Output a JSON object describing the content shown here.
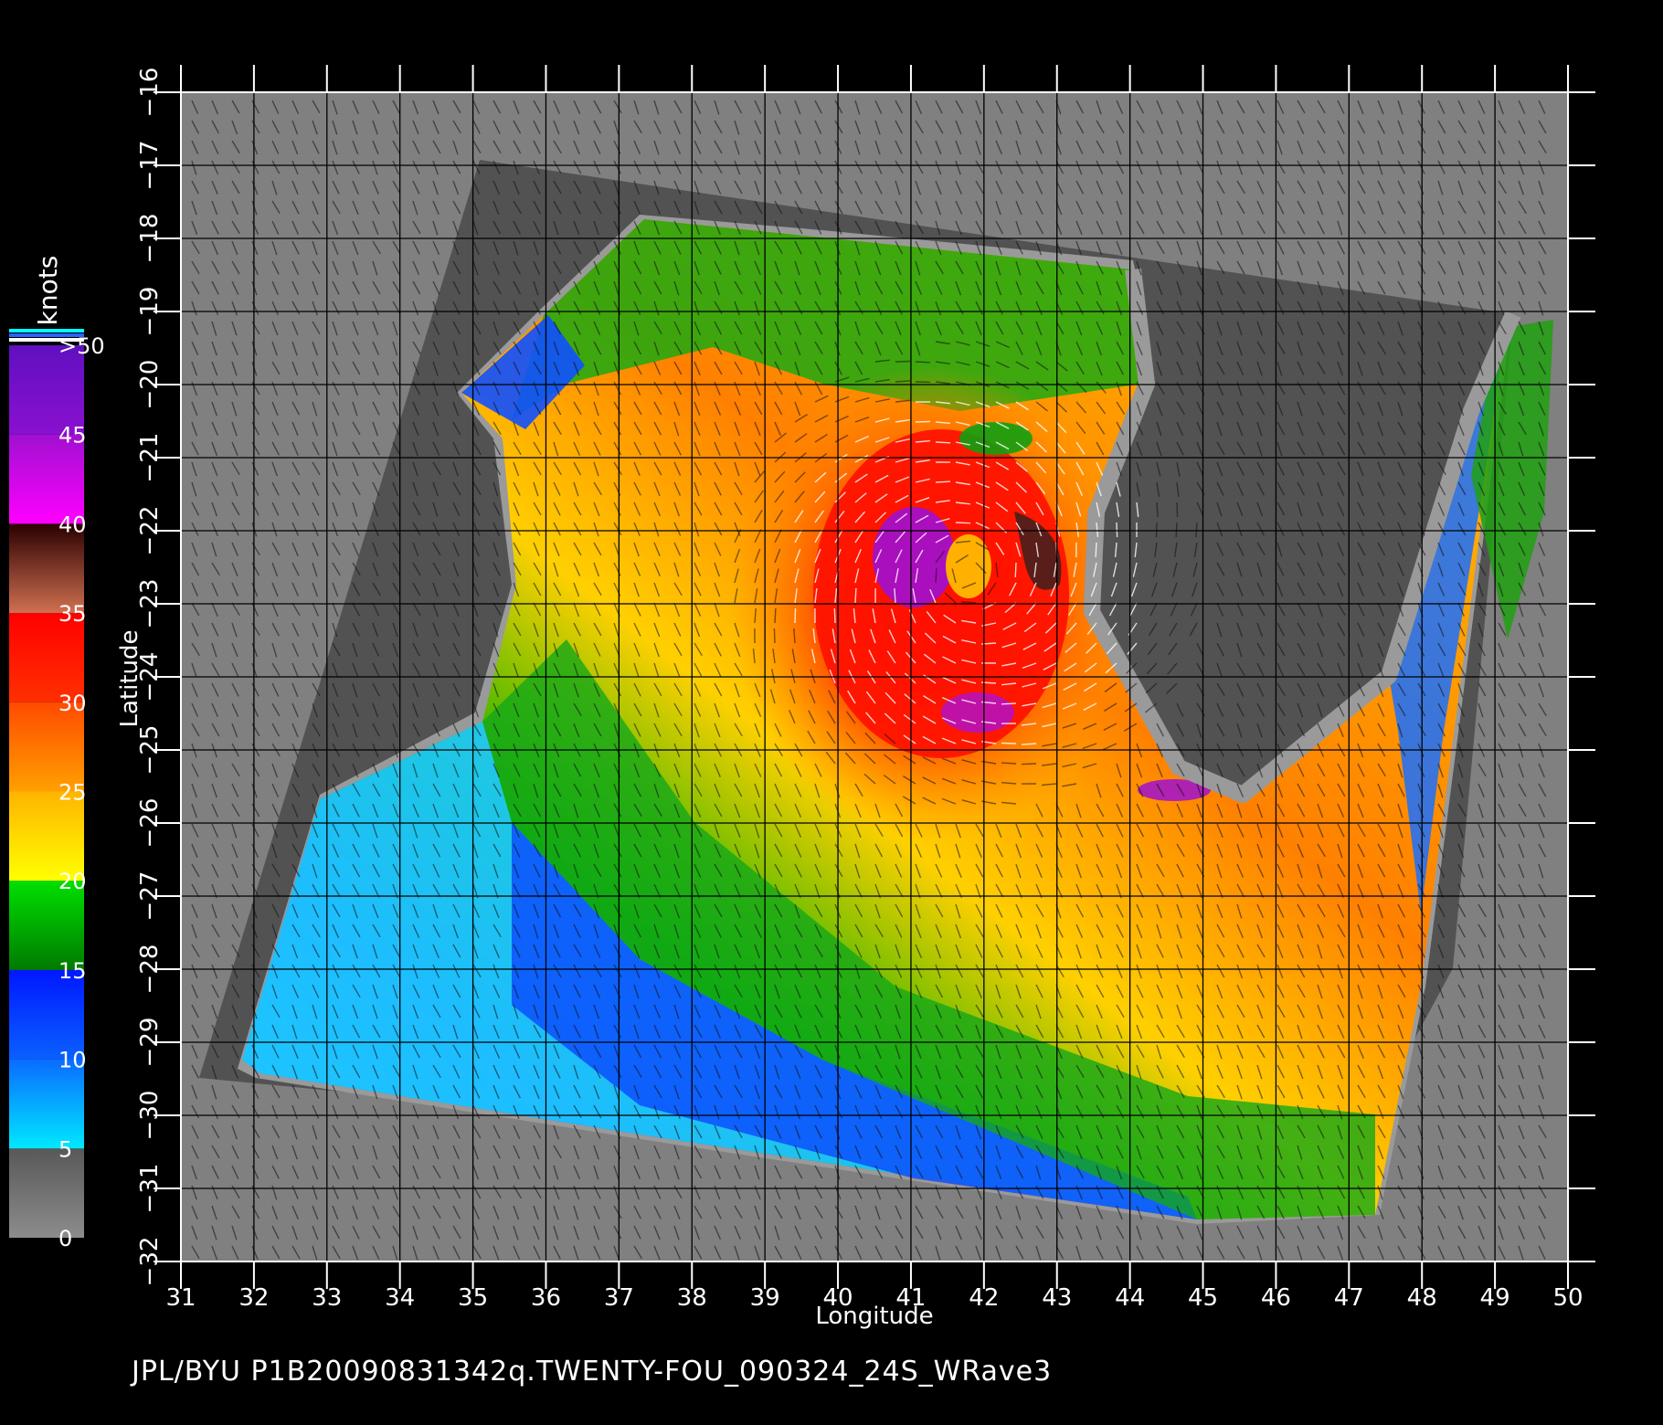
{
  "footer_text": "JPL/BYU  P1B20090831342q.TWENTY-FOU_090324_24S_WRave3",
  "colorbar": {
    "unit_label": "knots",
    "tick_labels": [
      "0",
      "5",
      "10",
      "15",
      "20",
      "25",
      "30",
      "35",
      "40",
      "45",
      ">50"
    ],
    "bands": [
      {
        "from": 0,
        "to": 5,
        "top": "#585858",
        "bottom": "#8c8c8c"
      },
      {
        "from": 5,
        "to": 10,
        "top": "#0a6bff",
        "bottom": "#00e8ff"
      },
      {
        "from": 10,
        "to": 15,
        "top": "#0018ff",
        "bottom": "#0a60ff"
      },
      {
        "from": 15,
        "to": 20,
        "top": "#00e000",
        "bottom": "#007a00"
      },
      {
        "from": 20,
        "to": 25,
        "top": "#ffb400",
        "bottom": "#ffff00"
      },
      {
        "from": 25,
        "to": 30,
        "top": "#ff4a00",
        "bottom": "#ffa000"
      },
      {
        "from": 30,
        "to": 35,
        "top": "#ff0000",
        "bottom": "#ff3000"
      },
      {
        "from": 35,
        "to": 40,
        "top": "#2a0000",
        "bottom": "#d07050"
      },
      {
        "from": 40,
        "to": 45,
        "top": "#a010d0",
        "bottom": "#ff00ff"
      },
      {
        "from": 45,
        "to": 50,
        "top": "#6010c0",
        "bottom": "#8a10d0"
      }
    ],
    "top_stripe_colors": [
      "#00ffff",
      "#3060ff",
      "#ffffff"
    ]
  },
  "map": {
    "x_axis_label": "Longitude",
    "y_axis_label": "Latitude",
    "lon_ticks": [
      "31",
      "32",
      "33",
      "34",
      "35",
      "36",
      "37",
      "38",
      "39",
      "40",
      "41",
      "42",
      "43",
      "44",
      "45",
      "46",
      "47",
      "48",
      "49",
      "50"
    ],
    "lat_ticks": [
      "−16",
      "−17",
      "−18",
      "−19",
      "−20",
      "−21",
      "−22",
      "−23",
      "−24",
      "−25",
      "−26",
      "−27",
      "−28",
      "−29",
      "−30",
      "−31",
      "−32"
    ],
    "lon_range": [
      31,
      50
    ],
    "lat_range": [
      -16,
      -32
    ],
    "grid": true,
    "background_color": "#808080",
    "no_data_color": "#525252",
    "storm_center": {
      "lon": 41.8,
      "lat": -22.6
    }
  }
}
